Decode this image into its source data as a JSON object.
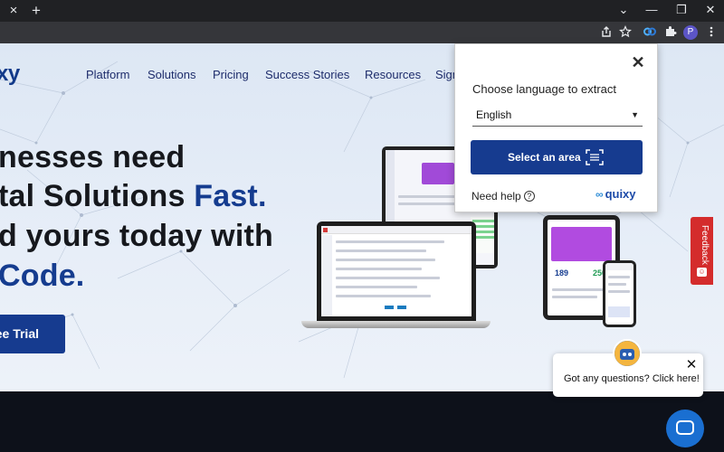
{
  "browser": {
    "tab_close": "×",
    "new_tab": "+",
    "window_controls": [
      "⌄",
      "—",
      "❐",
      "✕"
    ],
    "profile_initial": "P"
  },
  "site": {
    "logo": "xy",
    "nav": [
      "Platform",
      "Solutions",
      "Pricing",
      "Success Stories",
      "Resources",
      "Sign"
    ],
    "hero": {
      "line1": "nesses need",
      "line2_a": "tal Solutions ",
      "line2_b": "Fast.",
      "line3": "d yours today with",
      "line4": "Code."
    },
    "cta": "ee Trial"
  },
  "devices": {
    "tablet_stat_1": "189",
    "tablet_stat_2": "250"
  },
  "extension_popup": {
    "close": "✕",
    "label": "Choose language to extract",
    "language": "English",
    "select_button": "Select an area",
    "help": "Need help",
    "brand": "quixy"
  },
  "feedback": {
    "label": "Feedback"
  },
  "chat": {
    "prompt": "Got any questions? Click here!",
    "close": "✕"
  },
  "colors": {
    "brand_blue": "#163b8f",
    "feedback_red": "#d42c2c",
    "chat_blue": "#1a6fd1"
  }
}
